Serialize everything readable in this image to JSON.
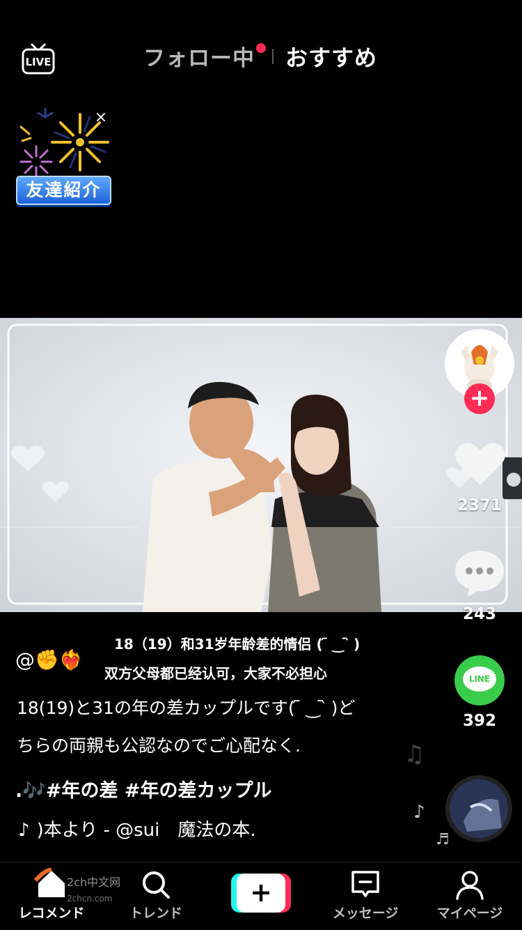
{
  "top_tabs": {
    "follow": "フォロー中",
    "recommend": "おすすめ"
  },
  "live": {
    "label": "LIVE"
  },
  "friend_intro": {
    "label": "友達紹介",
    "close": "×"
  },
  "actions": {
    "likes": "2371",
    "comments": "243",
    "shares": "392",
    "share_app": "LINE"
  },
  "caption": {
    "cn_title": "18（19）和31岁年龄差的情侣 ( ᷇ ‿ ᷆ )",
    "author_prefix": "@✊❤️‍🔥",
    "cn_sub": "双方父母都已经认可，大家不必担心",
    "desc_line1": "18(19)と31の年の差カップルです( ᷇ ‿ ᷆ )ど",
    "desc_line2": "ちらの両親も公認なのでご心配なく.",
    "hashtags": ".🎶#年の差 #年の差カップル",
    "music": ")本より - @sui　魔法の本."
  },
  "bottom_nav": {
    "home": "レコメンド",
    "trend": "トレンド",
    "create": "+",
    "messages": "メッセージ",
    "profile": "マイページ"
  },
  "watermark": {
    "line1": "2ch中文网",
    "line2": "2chcn.com"
  },
  "colors": {
    "accent": "#fe2c55",
    "line_green": "#3acd4b",
    "cyan": "#25f4ee"
  }
}
